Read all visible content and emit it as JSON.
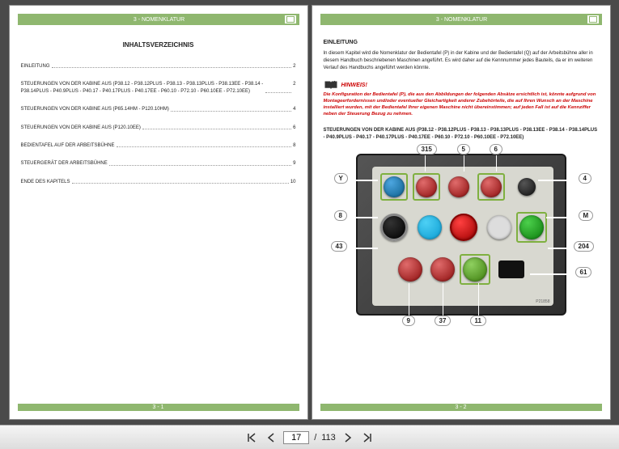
{
  "chapter_header": "3 - NOMENKLATUR",
  "left_page": {
    "toc_title": "INHALTSVERZEICHNIS",
    "entries": [
      {
        "label": "EINLEITUNG",
        "page": "2"
      },
      {
        "label": "STEUERUNGEN VON DER KABINE AUS (P38.12 - P38.12PLUS - P38.13 - P38.13PLUS - P38.13EE - P38.14 - P38.14PLUS - P40.9PLUS - P40.17 - P40.17PLUS - P40.17EE - P60.10 - P72.10 - P60.10EE - P72.10EE)",
        "page": "2"
      },
      {
        "label": "STEUERUNGEN VON DER KABINE AUS (P65.14HM - P120.10HM)",
        "page": "4"
      },
      {
        "label": "STEUERUNGEN VON DER KABINE AUS (P120.10EE)",
        "page": "6"
      },
      {
        "label": "BEDIENTAFEL AUF DER ARBEITSBÜHNE",
        "page": "8"
      },
      {
        "label": "STEUERGERÄT DER ARBEITSBÜHNE",
        "page": "9"
      },
      {
        "label": "ENDE DES KAPITELS",
        "page": "10"
      }
    ],
    "footer": "3 - 1"
  },
  "right_page": {
    "intro_title": "EINLEITUNG",
    "intro_text": "In diesem Kapitel wird die Nomenklatur der Bedientafel (P) in der Kabine und der Bedientafel (Q) auf der Arbeitsbühne aller in diesem Handbuch beschriebenen Maschinen angeführt. Es wird daher auf die Kennnummer jedes Bauteils, da er im weiteren Verlauf des Handbuchs angeführt werden könnte.",
    "hinweis_label": "HINWEIS!",
    "hinweis_text": "Die Konfiguration der Bedientafel (P), die aus den Abbildungen der folgenden Absätze ersichtlich ist, könnte aufgrund von Montageerfordernissen und/oder eventueller Gleichartigkeit anderer Zubehörteile, die auf Ihren Wunsch an der Maschine installiert wurden, mit der Bedientafel Ihrer eigenen Maschine nicht übereinstimmen; auf jeden Fall ist auf die Kennziffer neben der Steuerung Bezug zu nehmen.",
    "panel_caption": "STEUERUNGEN VON DER KABINE AUS (P38.12 - P38.12PLUS - P38.13 - P38.13PLUS - P38.13EE - P38.14 - P38.14PLUS - P40.9PLUS - P40.17 - P40.17PLUS - P40.17EE - P60.10 - P72.10 - P60.10EE - P72.10EE)",
    "image_ref": "P21858",
    "callouts": [
      "315",
      "5",
      "6",
      "Y",
      "4",
      "8",
      "M",
      "43",
      "204",
      "9",
      "37",
      "11",
      "61"
    ],
    "footer": "3 - 2"
  },
  "toolbar": {
    "current_page": "17",
    "total_pages": "113",
    "sep": "/"
  }
}
